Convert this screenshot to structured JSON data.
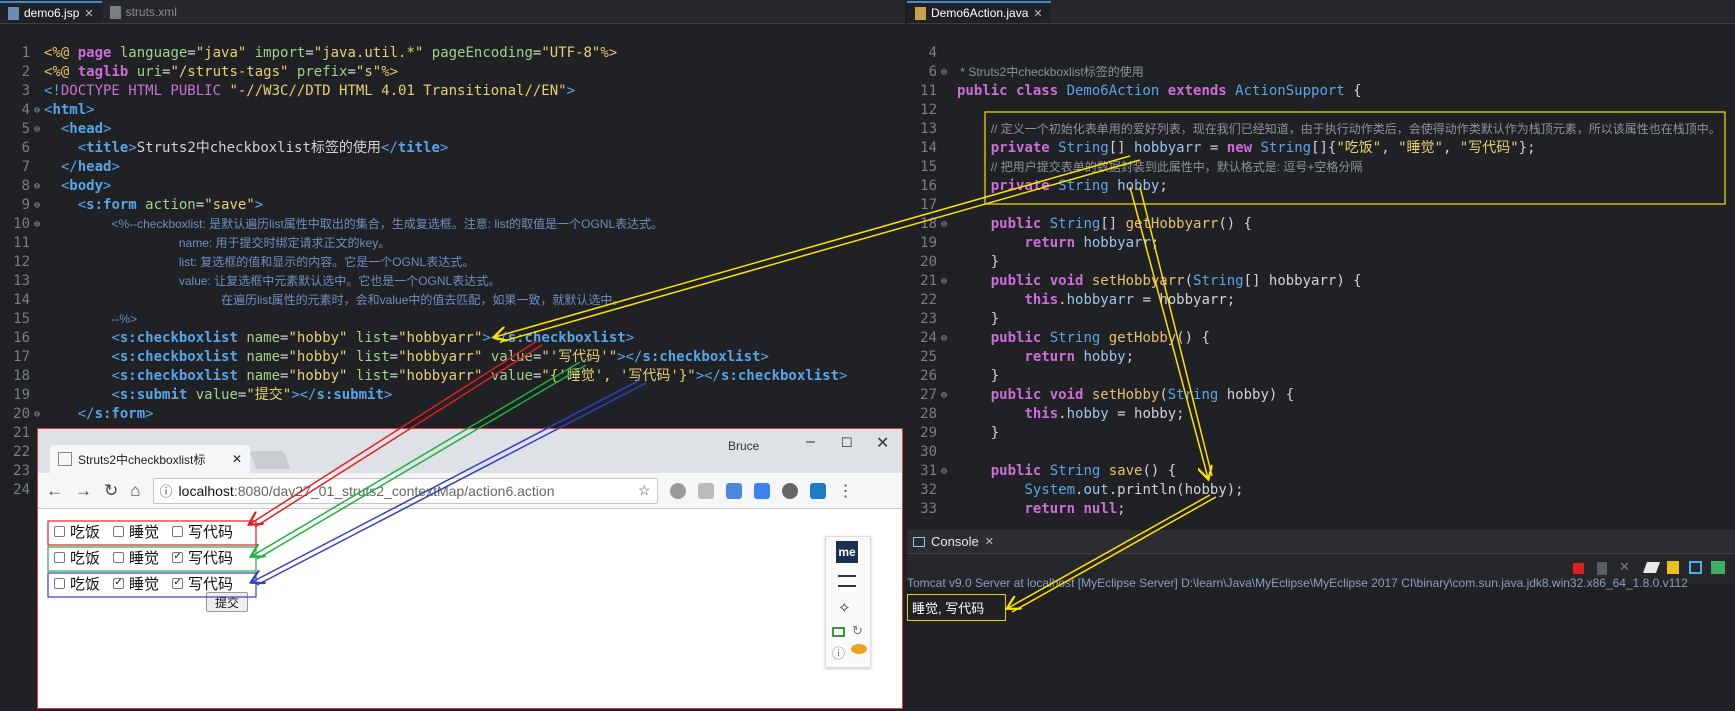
{
  "left_editor": {
    "tabs": [
      {
        "label": "demo6.jsp",
        "active": true
      },
      {
        "label": "struts.xml",
        "active": false
      }
    ],
    "lines": [
      {
        "n": "1",
        "tokens": [
          [
            "dir",
            "<%@ "
          ],
          [
            "kw",
            "page"
          ],
          [
            "attr",
            " language"
          ],
          [
            "plain",
            "="
          ],
          [
            "str",
            "\"java\""
          ],
          [
            "attr",
            " import"
          ],
          [
            "plain",
            "="
          ],
          [
            "str",
            "\"java.util.*\""
          ],
          [
            "attr",
            " pageEncoding"
          ],
          [
            "plain",
            "="
          ],
          [
            "str",
            "\"UTF-8\""
          ],
          [
            "dir",
            "%>"
          ]
        ]
      },
      {
        "n": "2",
        "tokens": [
          [
            "dir",
            "<%@ "
          ],
          [
            "kw",
            "taglib"
          ],
          [
            "attr",
            " uri"
          ],
          [
            "plain",
            "="
          ],
          [
            "str",
            "\"/struts-tags\""
          ],
          [
            "attr",
            " prefix"
          ],
          [
            "plain",
            "="
          ],
          [
            "str",
            "\"s\""
          ],
          [
            "dir",
            "%>"
          ]
        ]
      },
      {
        "n": "3",
        "tokens": [
          [
            "tag",
            "<!"
          ],
          [
            "kw2",
            "DOCTYPE HTML PUBLIC "
          ],
          [
            "str",
            "\"-//W3C//DTD HTML 4.01 Transitional//EN\""
          ],
          [
            "tag",
            ">"
          ]
        ]
      },
      {
        "n": "4",
        "fold": true,
        "tokens": [
          [
            "tag",
            "<"
          ],
          [
            "tagb",
            "html"
          ],
          [
            "tag",
            ">"
          ]
        ]
      },
      {
        "n": "5",
        "fold": true,
        "tokens": [
          [
            "plain",
            "  "
          ],
          [
            "tag",
            "<"
          ],
          [
            "tagb",
            "head"
          ],
          [
            "tag",
            ">"
          ]
        ]
      },
      {
        "n": "6",
        "tokens": [
          [
            "plain",
            "    "
          ],
          [
            "tag",
            "<"
          ],
          [
            "tagb",
            "title"
          ],
          [
            "tag",
            ">"
          ],
          [
            "plain",
            "Struts2中checkboxlist标签的使用"
          ],
          [
            "tag",
            "</"
          ],
          [
            "tagb",
            "title"
          ],
          [
            "tag",
            ">"
          ]
        ]
      },
      {
        "n": "7",
        "tokens": [
          [
            "plain",
            "  "
          ],
          [
            "tag",
            "</"
          ],
          [
            "tagb",
            "head"
          ],
          [
            "tag",
            ">"
          ]
        ]
      },
      {
        "n": "8",
        "fold": true,
        "tokens": [
          [
            "plain",
            "  "
          ],
          [
            "tag",
            "<"
          ],
          [
            "tagb",
            "body"
          ],
          [
            "tag",
            ">"
          ]
        ]
      },
      {
        "n": "9",
        "fold": true,
        "tokens": [
          [
            "plain",
            "    "
          ],
          [
            "tag",
            "<"
          ],
          [
            "tagb",
            "s:form"
          ],
          [
            "attr",
            " action"
          ],
          [
            "plain",
            "="
          ],
          [
            "str",
            "\"save\""
          ],
          [
            "tag",
            ">"
          ]
        ]
      },
      {
        "n": "10",
        "fold": true,
        "tokens": [
          [
            "plain",
            "        "
          ],
          [
            "cmt",
            "<%--checkboxlist: 是默认遍历list属性中取出的集合，生成复选框。注意: list的取值是一个OGNL表达式。"
          ]
        ]
      },
      {
        "n": "11",
        "tokens": [
          [
            "plain",
            "                "
          ],
          [
            "cmt",
            "name: 用于提交时绑定请求正文的key。"
          ]
        ]
      },
      {
        "n": "12",
        "tokens": [
          [
            "plain",
            "                "
          ],
          [
            "cmt",
            "list: 复选框的值和显示的内容。它是一个OGNL表达式。"
          ]
        ]
      },
      {
        "n": "13",
        "tokens": [
          [
            "plain",
            "                "
          ],
          [
            "cmt",
            "value: 让复选框中元素默认选中。它也是一个OGNL表达式。"
          ]
        ]
      },
      {
        "n": "14",
        "tokens": [
          [
            "plain",
            "                     "
          ],
          [
            "cmt",
            "在遍历list属性的元素时，会和value中的值去匹配，如果一致，就默认选中。"
          ]
        ]
      },
      {
        "n": "15",
        "tokens": [
          [
            "plain",
            "        "
          ],
          [
            "cmt",
            "--%>"
          ]
        ]
      },
      {
        "n": "16",
        "tokens": [
          [
            "plain",
            "        "
          ],
          [
            "tag",
            "<"
          ],
          [
            "tagb",
            "s:checkboxlist"
          ],
          [
            "attr",
            " name"
          ],
          [
            "plain",
            "="
          ],
          [
            "str",
            "\"hobby\""
          ],
          [
            "attr",
            " list"
          ],
          [
            "plain",
            "="
          ],
          [
            "str",
            "\"hobbyarr\""
          ],
          [
            "tag",
            "></"
          ],
          [
            "tagb",
            "s:checkboxlist"
          ],
          [
            "tag",
            ">"
          ]
        ]
      },
      {
        "n": "17",
        "tokens": [
          [
            "plain",
            "        "
          ],
          [
            "tag",
            "<"
          ],
          [
            "tagb",
            "s:checkboxlist"
          ],
          [
            "attr",
            " name"
          ],
          [
            "plain",
            "="
          ],
          [
            "str",
            "\"hobby\""
          ],
          [
            "attr",
            " list"
          ],
          [
            "plain",
            "="
          ],
          [
            "str",
            "\"hobbyarr\""
          ],
          [
            "attr",
            " value"
          ],
          [
            "plain",
            "="
          ],
          [
            "str",
            "\"'写代码'\""
          ],
          [
            "tag",
            "></"
          ],
          [
            "tagb",
            "s:checkboxlist"
          ],
          [
            "tag",
            ">"
          ]
        ]
      },
      {
        "n": "18",
        "tokens": [
          [
            "plain",
            "        "
          ],
          [
            "tag",
            "<"
          ],
          [
            "tagb",
            "s:checkboxlist"
          ],
          [
            "attr",
            " name"
          ],
          [
            "plain",
            "="
          ],
          [
            "str",
            "\"hobby\""
          ],
          [
            "attr",
            " list"
          ],
          [
            "plain",
            "="
          ],
          [
            "str",
            "\"hobbyarr\""
          ],
          [
            "attr",
            " value"
          ],
          [
            "plain",
            "="
          ],
          [
            "str",
            "\"{'睡觉', '写代码'}\""
          ],
          [
            "tag",
            "></"
          ],
          [
            "tagb",
            "s:checkboxlist"
          ],
          [
            "tag",
            ">"
          ]
        ]
      },
      {
        "n": "19",
        "tokens": [
          [
            "plain",
            "        "
          ],
          [
            "tag",
            "<"
          ],
          [
            "tagb",
            "s:submit"
          ],
          [
            "attr",
            " value"
          ],
          [
            "plain",
            "="
          ],
          [
            "str",
            "\"提交\""
          ],
          [
            "tag",
            "></"
          ],
          [
            "tagb",
            "s:submit"
          ],
          [
            "tag",
            ">"
          ]
        ]
      },
      {
        "n": "20",
        "fold": true,
        "tokens": [
          [
            "plain",
            "    "
          ],
          [
            "tag",
            "</"
          ],
          [
            "tagb",
            "s:form"
          ],
          [
            "tag",
            ">"
          ]
        ]
      },
      {
        "n": "21",
        "tokens": []
      },
      {
        "n": "22",
        "tokens": []
      },
      {
        "n": "23",
        "tokens": []
      },
      {
        "n": "24",
        "tokens": []
      }
    ]
  },
  "right_editor": {
    "tabs": [
      {
        "label": "Demo6Action.java",
        "active": true
      }
    ],
    "lines": [
      {
        "n": "4",
        "tokens": []
      },
      {
        "n": "6",
        "fold": true,
        "tokens": [
          [
            "cmtj",
            " * Struts2中checkboxlist标签的使用"
          ]
        ]
      },
      {
        "n": "11",
        "tokens": [
          [
            "kw",
            "public class "
          ],
          [
            "typ",
            "Demo6Action"
          ],
          [
            "kw",
            " extends "
          ],
          [
            "typ",
            "ActionSupport"
          ],
          [
            "plain",
            " {"
          ]
        ]
      },
      {
        "n": "12",
        "tokens": []
      },
      {
        "n": "13",
        "tokens": [
          [
            "plain",
            "    "
          ],
          [
            "cmtj",
            "// 定义一个初始化表单用的爱好列表，现在我们已经知道，由于执行动作类后，会使得动作类默认作为栈顶元素，所以该属性也在栈顶中。"
          ]
        ]
      },
      {
        "n": "14",
        "tokens": [
          [
            "plain",
            "    "
          ],
          [
            "kw",
            "private "
          ],
          [
            "typ",
            "String"
          ],
          [
            "plain",
            "[] "
          ],
          [
            "fld",
            "hobbyarr"
          ],
          [
            "plain",
            " = "
          ],
          [
            "kw",
            "new "
          ],
          [
            "typ",
            "String"
          ],
          [
            "plain",
            "[]{"
          ],
          [
            "str",
            "\"吃饭\""
          ],
          [
            "plain",
            ", "
          ],
          [
            "str",
            "\"睡觉\""
          ],
          [
            "plain",
            ", "
          ],
          [
            "str",
            "\"写代码\""
          ],
          [
            "plain",
            "};"
          ]
        ]
      },
      {
        "n": "15",
        "tokens": [
          [
            "plain",
            "    "
          ],
          [
            "cmtj",
            "// 把用户提交表单的数据封装到此属性中，默认格式是: 逗号+空格分隔"
          ]
        ]
      },
      {
        "n": "16",
        "tokens": [
          [
            "plain",
            "    "
          ],
          [
            "kw",
            "private "
          ],
          [
            "typ",
            "String "
          ],
          [
            "fld",
            "hobby"
          ],
          [
            "plain",
            ";"
          ]
        ]
      },
      {
        "n": "17",
        "tokens": []
      },
      {
        "n": "18",
        "fold": true,
        "tokens": [
          [
            "plain",
            "    "
          ],
          [
            "kw",
            "public "
          ],
          [
            "typ",
            "String"
          ],
          [
            "plain",
            "[] "
          ],
          [
            "meth",
            "getHobbyarr"
          ],
          [
            "plain",
            "() {"
          ]
        ]
      },
      {
        "n": "19",
        "tokens": [
          [
            "plain",
            "        "
          ],
          [
            "kw",
            "return "
          ],
          [
            "fld",
            "hobbyarr"
          ],
          [
            "plain",
            ";"
          ]
        ]
      },
      {
        "n": "20",
        "tokens": [
          [
            "plain",
            "    }"
          ]
        ]
      },
      {
        "n": "21",
        "fold": true,
        "tokens": [
          [
            "plain",
            "    "
          ],
          [
            "kw",
            "public void "
          ],
          [
            "meth",
            "setHobbyarr"
          ],
          [
            "plain",
            "("
          ],
          [
            "typ",
            "String"
          ],
          [
            "plain",
            "[] hobbyarr) {"
          ]
        ]
      },
      {
        "n": "22",
        "tokens": [
          [
            "plain",
            "        "
          ],
          [
            "kw",
            "this"
          ],
          [
            "plain",
            "."
          ],
          [
            "fld",
            "hobbyarr"
          ],
          [
            "plain",
            " = hobbyarr;"
          ]
        ]
      },
      {
        "n": "23",
        "tokens": [
          [
            "plain",
            "    }"
          ]
        ]
      },
      {
        "n": "24",
        "fold": true,
        "tokens": [
          [
            "plain",
            "    "
          ],
          [
            "kw",
            "public "
          ],
          [
            "typ",
            "String "
          ],
          [
            "meth",
            "getHobby"
          ],
          [
            "plain",
            "() {"
          ]
        ]
      },
      {
        "n": "25",
        "tokens": [
          [
            "plain",
            "        "
          ],
          [
            "kw",
            "return "
          ],
          [
            "fld",
            "hobby"
          ],
          [
            "plain",
            ";"
          ]
        ]
      },
      {
        "n": "26",
        "tokens": [
          [
            "plain",
            "    }"
          ]
        ]
      },
      {
        "n": "27",
        "fold": true,
        "tokens": [
          [
            "plain",
            "    "
          ],
          [
            "kw",
            "public void "
          ],
          [
            "meth",
            "setHobby"
          ],
          [
            "plain",
            "("
          ],
          [
            "typ",
            "String"
          ],
          [
            "plain",
            " hobby) {"
          ]
        ]
      },
      {
        "n": "28",
        "tokens": [
          [
            "plain",
            "        "
          ],
          [
            "kw",
            "this"
          ],
          [
            "plain",
            "."
          ],
          [
            "fld",
            "hobby"
          ],
          [
            "plain",
            " = hobby;"
          ]
        ]
      },
      {
        "n": "29",
        "tokens": [
          [
            "plain",
            "    }"
          ]
        ]
      },
      {
        "n": "30",
        "tokens": []
      },
      {
        "n": "31",
        "fold": true,
        "tokens": [
          [
            "plain",
            "    "
          ],
          [
            "kw",
            "public "
          ],
          [
            "typ",
            "String "
          ],
          [
            "meth",
            "save"
          ],
          [
            "plain",
            "() {"
          ]
        ]
      },
      {
        "n": "32",
        "tokens": [
          [
            "plain",
            "        "
          ],
          [
            "typ",
            "System"
          ],
          [
            "plain",
            "."
          ],
          [
            "fld",
            "out"
          ],
          [
            "plain",
            ".println(hobby);"
          ]
        ]
      },
      {
        "n": "33",
        "tokens": [
          [
            "plain",
            "        "
          ],
          [
            "kw",
            "return null"
          ],
          [
            "plain",
            ";"
          ]
        ]
      }
    ]
  },
  "browser": {
    "tab_title": "Struts2中checkboxlist标",
    "user": "Bruce",
    "url_host": "localhost",
    "url_rest": ":8080/day27_01_struts2_contextMap/action6.action",
    "rows": [
      {
        "items": [
          [
            "吃饭",
            false
          ],
          [
            "睡觉",
            false
          ],
          [
            "写代码",
            false
          ]
        ],
        "border": "#e02020"
      },
      {
        "items": [
          [
            "吃饭",
            false
          ],
          [
            "睡觉",
            false
          ],
          [
            "写代码",
            true
          ]
        ],
        "border": "#20b040"
      },
      {
        "items": [
          [
            "吃饭",
            false
          ],
          [
            "睡觉",
            true
          ],
          [
            "写代码",
            true
          ]
        ],
        "border": "#3040c0"
      }
    ],
    "submit_label": "提交",
    "ext_badge": "me"
  },
  "console": {
    "tab_label": "Console",
    "path": "Tomcat v9.0 Server at localhost [MyEclipse Server] D:\\learn\\Java\\MyEclipse\\MyEclipse 2017 CI\\binary\\com.sun.java.jdk8.win32.x86_64_1.8.0.v112",
    "output": "睡觉, 写代码"
  },
  "colors": {
    "arrow_yellow": "#ffe100",
    "arrow_red": "#e02020",
    "arrow_green": "#20b040",
    "arrow_blue": "#3040c0"
  }
}
